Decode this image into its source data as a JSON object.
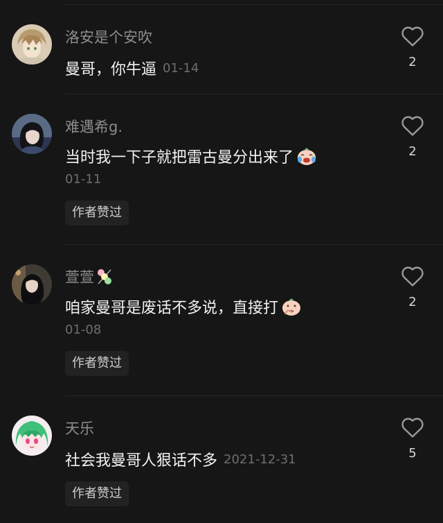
{
  "comments": [
    {
      "username": "洛安是个安吹",
      "text": "曼哥，你牛逼",
      "date": "01-14",
      "likes": "2",
      "author_liked": ""
    },
    {
      "username": "难遇希g.",
      "text": "当时我一下子就把雷古曼分出来了",
      "date": "01-11",
      "likes": "2",
      "author_liked": "作者赞过"
    },
    {
      "username": "萱萱",
      "text": "咱家曼哥是废话不多说，直接打",
      "date": "01-08",
      "likes": "2",
      "author_liked": "作者赞过"
    },
    {
      "username": "天乐",
      "text": "社会我曼哥人狠话不多",
      "date": "2021-12-31",
      "likes": "5",
      "author_liked": "作者赞过"
    }
  ],
  "icons": {
    "like": "heart-outline-icon",
    "emoji_laugh_cry": "laughing-tears-emoji",
    "emoji_thinking": "thinking-emoji",
    "username_emoji": "dango-emoji"
  },
  "colors": {
    "background": "#161616",
    "username": "#8d8d8d",
    "text": "#f2f2f2",
    "muted": "#6e6e6e",
    "badge_bg": "#222222"
  }
}
